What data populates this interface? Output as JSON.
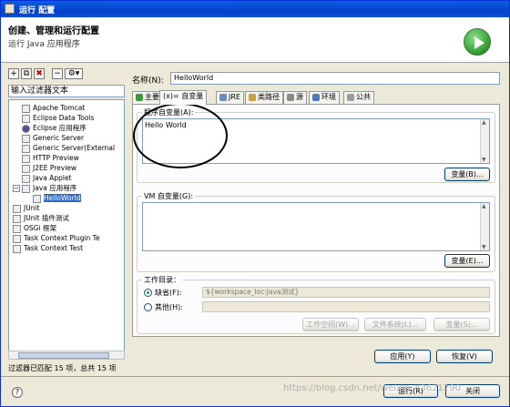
{
  "window": {
    "title": "运行 配置"
  },
  "header": {
    "title": "创建、管理和运行配置",
    "subtitle": "运行 Java 应用程序",
    "run_icon": "run-icon"
  },
  "left": {
    "toolbar": [
      "new-config-icon",
      "duplicate-icon",
      "delete-icon",
      "collapse-icon",
      "filter-icon"
    ],
    "filter_text": "输入过滤器文本",
    "tree": [
      {
        "label": "Apache Tomcat",
        "icon": "tomcat-icon"
      },
      {
        "label": "Eclipse Data Tools",
        "icon": "data-tools-icon"
      },
      {
        "label": "Eclipse 应用程序",
        "icon": "eclipse-icon"
      },
      {
        "label": "Generic Server",
        "icon": "server-icon"
      },
      {
        "label": "Generic Server(External",
        "icon": "server-icon"
      },
      {
        "label": "HTTP Preview",
        "icon": "http-icon"
      },
      {
        "label": "J2EE Preview",
        "icon": "j2ee-icon"
      },
      {
        "label": "Java Applet",
        "icon": "applet-icon"
      },
      {
        "label": "Java 应用程序",
        "icon": "java-app-icon"
      },
      {
        "label": "HelloWorld",
        "icon": "java-class-icon"
      },
      {
        "label": "JUnit",
        "icon": "junit-icon"
      },
      {
        "label": "JUnit 插件测试",
        "icon": "junit-plugin-icon"
      },
      {
        "label": "OSGi 框架",
        "icon": "osgi-icon"
      },
      {
        "label": "Task Context Plugin Te",
        "icon": "task-icon"
      },
      {
        "label": "Task Context Test",
        "icon": "task-icon"
      }
    ],
    "status": "过滤器已匹配 15 项，总共 15 项"
  },
  "right": {
    "name_label": "名称(N):",
    "name_value": "HelloWorld",
    "tabs": [
      {
        "label": "主要",
        "icon": "main-tab-icon"
      },
      {
        "label": "(x)= 自变量",
        "icon": "args-tab-icon"
      },
      {
        "label": "JRE",
        "icon": "jre-tab-icon"
      },
      {
        "label": "类路径",
        "icon": "classpath-tab-icon"
      },
      {
        "label": "源",
        "icon": "source-tab-icon"
      },
      {
        "label": "环境",
        "icon": "env-tab-icon"
      },
      {
        "label": "公共",
        "icon": "common-tab-icon"
      }
    ],
    "program_args_label": "程序自变量(A):",
    "program_args_value": "Hello World",
    "variables_btn": "变量(B)...",
    "vm_args_label": "VM 自变量(G):",
    "vm_args_value": "",
    "variables_btn2": "变量(E)...",
    "workdir_label": "工作目录：",
    "default_radio": "缺省(F):",
    "default_value": "${workspace_loc:Java测试}",
    "other_radio": "其他(H):",
    "other_value": "",
    "workspace_btn": "工作空间(W)...",
    "filesystem_btn": "文件系统(L)...",
    "vars_btn3": "变量(S)...",
    "apply_btn": "应用(Y)",
    "revert_btn": "恢复(V)"
  },
  "footer": {
    "run_btn": "运行(R)",
    "close_btn": "关闭",
    "watermark": "https://blog.csdn.net/weixin_43621290"
  }
}
